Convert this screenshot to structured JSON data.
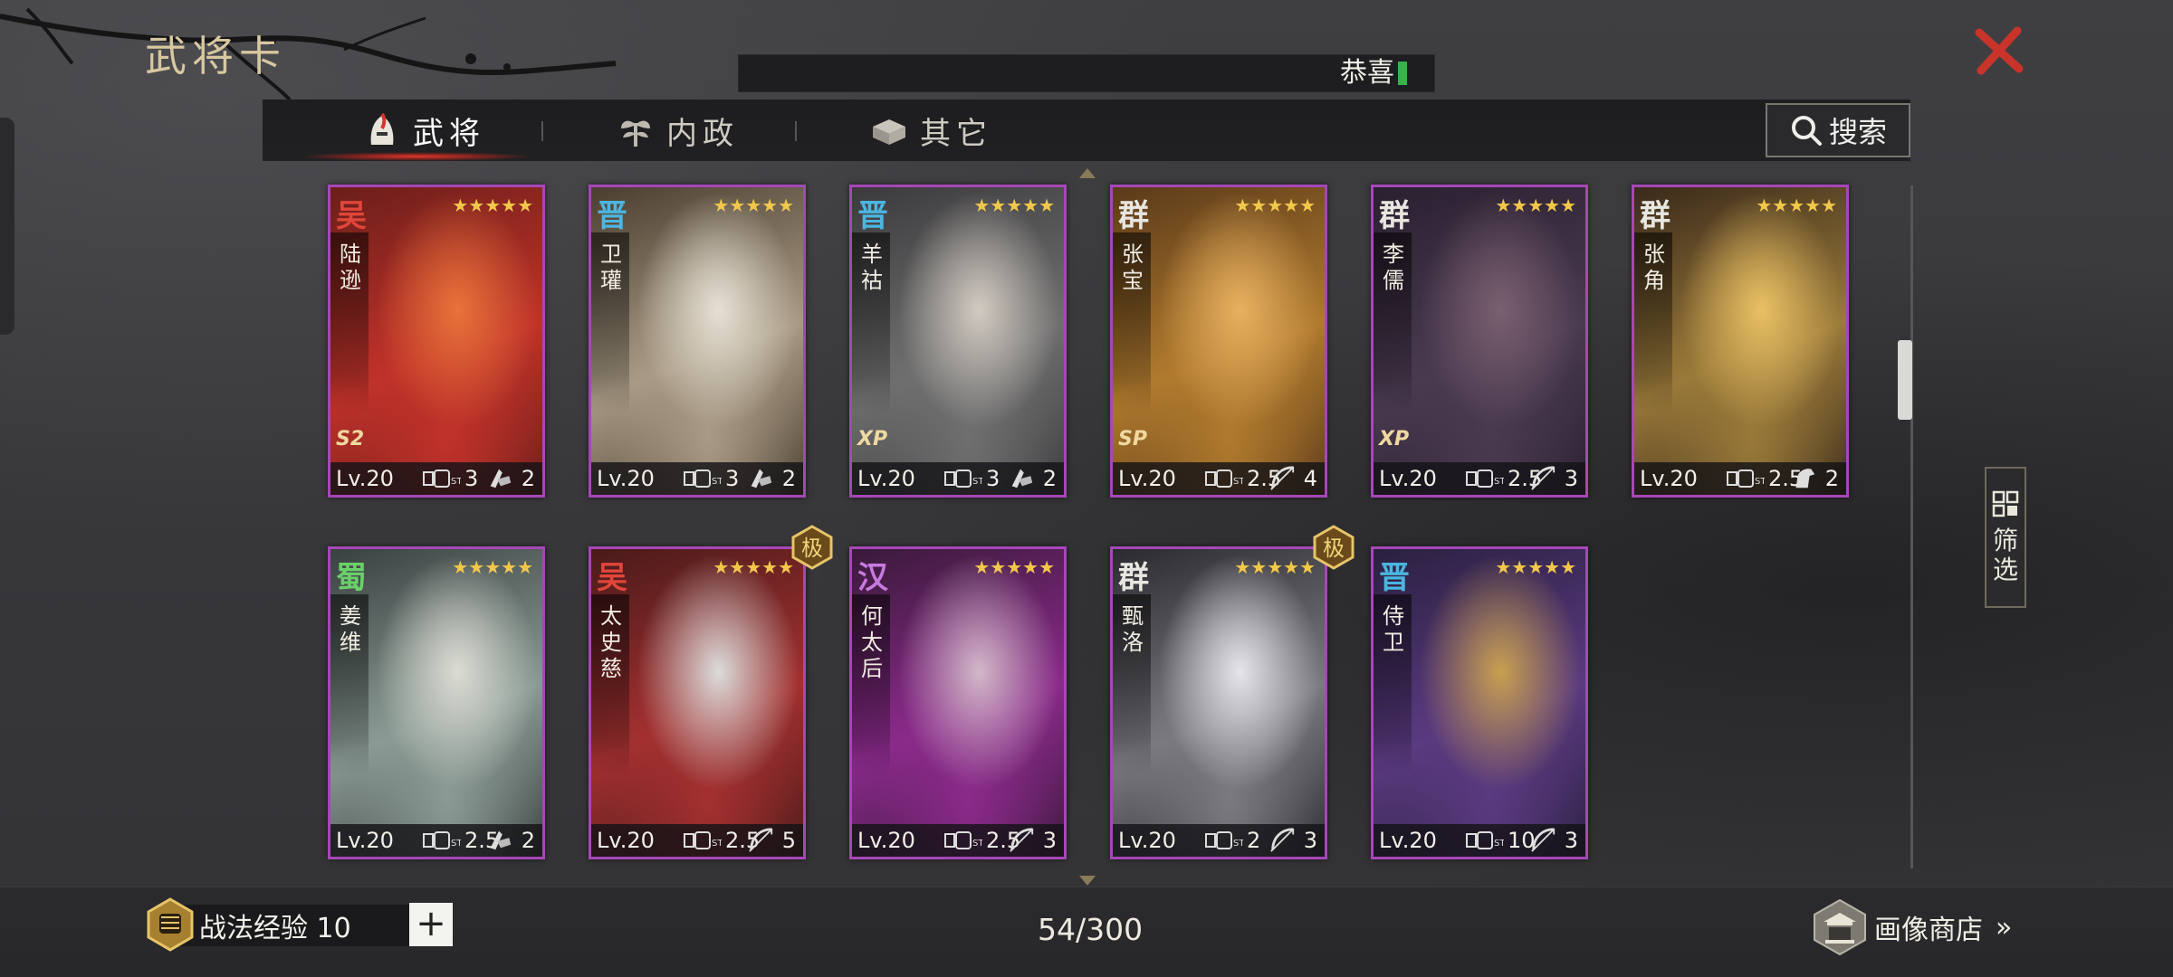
{
  "header": {
    "title": "武将卡",
    "marquee_text": "恭喜"
  },
  "tabs": [
    {
      "label": "武将",
      "active": true
    },
    {
      "label": "内政",
      "active": false
    },
    {
      "label": "其它",
      "active": false
    }
  ],
  "search": {
    "label": "搜索"
  },
  "filter": {
    "label_line1": "筛",
    "label_line2": "选"
  },
  "cards": [
    {
      "faction": "吴",
      "faction_color": "#e0463a",
      "name": "陆逊",
      "stars": "★★★★★",
      "tag": "S2",
      "level": "Lv.20",
      "cost": "3",
      "troop_icon": "infantry-icon",
      "troop_count": "2",
      "art_colors": [
        "#6b1e1a",
        "#c0322a",
        "#e8733a"
      ]
    },
    {
      "faction": "晋",
      "faction_color": "#4bb6e0",
      "name": "卫瓘",
      "stars": "★★★★★",
      "tag": "",
      "level": "Lv.20",
      "cost": "3",
      "troop_icon": "infantry-icon",
      "troop_count": "2",
      "art_colors": [
        "#4a3e30",
        "#a89a84",
        "#e6e0d4"
      ]
    },
    {
      "faction": "晋",
      "faction_color": "#4bb6e0",
      "name": "羊祜",
      "stars": "★★★★★",
      "tag": "XP",
      "level": "Lv.20",
      "cost": "3",
      "troop_icon": "infantry-icon",
      "troop_count": "2",
      "art_colors": [
        "#3b3a3c",
        "#6f6f70",
        "#d2cbc2"
      ]
    },
    {
      "faction": "群",
      "faction_color": "#e8e6e0",
      "name": "张宝",
      "stars": "★★★★★",
      "tag": "SP",
      "level": "Lv.20",
      "cost": "2.5",
      "troop_icon": "archer-icon",
      "troop_count": "4",
      "art_colors": [
        "#5a3a1a",
        "#b07a2e",
        "#e7b060"
      ]
    },
    {
      "faction": "群",
      "faction_color": "#e8e6e0",
      "name": "李儒",
      "stars": "★★★★★",
      "tag": "XP",
      "level": "Lv.20",
      "cost": "2.5",
      "troop_icon": "archer-icon",
      "troop_count": "3",
      "art_colors": [
        "#2a2030",
        "#4a3a50",
        "#7a6070"
      ]
    },
    {
      "faction": "群",
      "faction_color": "#e8e6e0",
      "name": "张角",
      "stars": "★★★★★",
      "tag": "",
      "level": "Lv.20",
      "cost": "2.5",
      "troop_icon": "cavalry-icon",
      "troop_count": "2",
      "art_colors": [
        "#3a2a1a",
        "#9a7a3a",
        "#e9c064"
      ]
    },
    {
      "faction": "蜀",
      "faction_color": "#6ad06a",
      "name": "姜维",
      "stars": "★★★★★",
      "tag": "",
      "level": "Lv.20",
      "cost": "2.5",
      "troop_icon": "infantry-icon",
      "troop_count": "2",
      "art_colors": [
        "#3a4040",
        "#8a9a94",
        "#dcdcd4"
      ]
    },
    {
      "faction": "吴",
      "faction_color": "#e0463a",
      "name": "太史慈",
      "stars": "★★★★★",
      "tag": "",
      "level": "Lv.20",
      "cost": "2.5",
      "troop_icon": "archer-icon",
      "troop_count": "5",
      "art_colors": [
        "#4a1a1a",
        "#a33030",
        "#dcdcdc"
      ],
      "rare_badge": "极"
    },
    {
      "faction": "汉",
      "faction_color": "#c77ae0",
      "name": "何太后",
      "stars": "★★★★★",
      "tag": "",
      "level": "Lv.20",
      "cost": "2.5",
      "troop_icon": "archer-icon",
      "troop_count": "3",
      "art_colors": [
        "#3a1a3a",
        "#8a2a8a",
        "#d2b8c8"
      ]
    },
    {
      "faction": "群",
      "faction_color": "#e8e6e0",
      "name": "甄洛",
      "stars": "★★★★★",
      "tag": "",
      "level": "Lv.20",
      "cost": "2",
      "troop_icon": "archer-icon",
      "troop_count": "3",
      "art_colors": [
        "#2a2a30",
        "#7a7a80",
        "#e6e6ea"
      ],
      "rare_badge": "极"
    },
    {
      "faction": "晋",
      "faction_color": "#4bb6e0",
      "name": "侍卫",
      "stars": "★★★★★",
      "tag": "",
      "level": "Lv.20",
      "cost": "10",
      "troop_icon": "archer-icon",
      "troop_count": "3",
      "art_colors": [
        "#2a2040",
        "#5a3a80",
        "#c8a050"
      ]
    }
  ],
  "footer": {
    "exp_label": "战法经验 10",
    "plus_label": "+",
    "count": "54/300",
    "shop_label": "画像商店",
    "shop_chevron": "»"
  }
}
